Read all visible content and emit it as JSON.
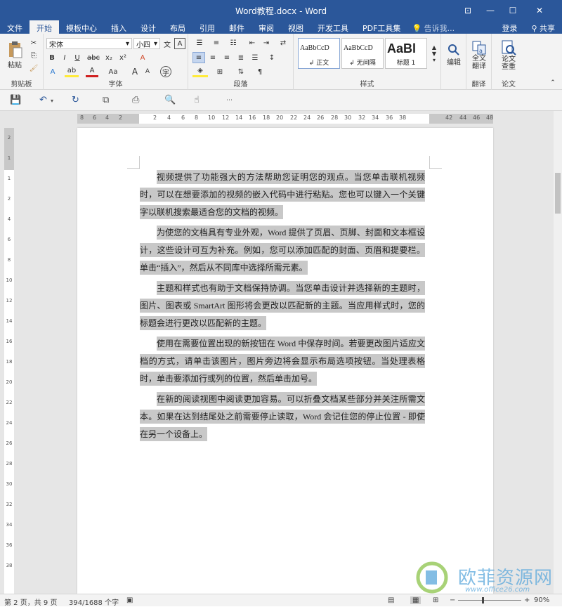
{
  "window": {
    "title": "Word教程.docx - Word",
    "minimize": "—",
    "maximize": "☐",
    "close": "✕",
    "ribbon_display": "⊡"
  },
  "tabs": [
    "文件",
    "开始",
    "模板中心",
    "插入",
    "设计",
    "布局",
    "引用",
    "邮件",
    "审阅",
    "视图",
    "开发工具",
    "PDF工具集"
  ],
  "active_tab": "开始",
  "tell_me": "告诉我...",
  "login": "登录",
  "share": "共享",
  "ribbon": {
    "clipboard": {
      "paste": "粘贴",
      "label": "剪贴板"
    },
    "font": {
      "name": "宋体",
      "size": "小四",
      "label": "字体",
      "bold": "B",
      "italic": "I",
      "underline": "U",
      "strike": "abc",
      "sub": "x₂",
      "sup": "x²",
      "grow": "A",
      "shrink": "A",
      "case": "Aa",
      "clear": "A",
      "phonetic": "文",
      "border": "A",
      "effect": "A",
      "highlight": "ab",
      "color": "A",
      "enclose": "字"
    },
    "paragraph": {
      "label": "段落"
    },
    "styles": {
      "label": "样式",
      "items": [
        {
          "sample": "AaBbCcD",
          "name": "↲ 正文"
        },
        {
          "sample": "AaBbCcD",
          "name": "↲ 无间隔"
        },
        {
          "sample": "AaBl",
          "name": "标题 1"
        }
      ]
    },
    "editing": {
      "label": "编辑"
    },
    "translate": {
      "btn": "全文\n翻译",
      "line1": "全文",
      "line2": "翻译",
      "label": "翻译"
    },
    "paper": {
      "line1": "论文",
      "line2": "查重",
      "label": "论文"
    }
  },
  "ruler": {
    "h_numbers": [
      "8",
      "6",
      "4",
      "2",
      "2",
      "4",
      "6",
      "8",
      "10",
      "12",
      "14",
      "16",
      "18",
      "20",
      "22",
      "24",
      "26",
      "28",
      "30",
      "32",
      "34",
      "36",
      "38",
      "42",
      "44",
      "46",
      "48"
    ],
    "v_numbers": [
      "2",
      "1",
      "1",
      "2",
      "4",
      "6",
      "8",
      "10",
      "12",
      "14",
      "16",
      "18",
      "20",
      "22",
      "24",
      "26",
      "28",
      "30",
      "32",
      "34",
      "36",
      "38"
    ],
    "corner": "L"
  },
  "document": {
    "paragraphs": [
      "视频提供了功能强大的方法帮助您证明您的观点。当您单击联机视频时，可以在想要添加的视频的嵌入代码中进行粘贴。您也可以键入一个关键字以联机搜索最适合您的文档的视频。",
      "为使您的文档具有专业外观，Word 提供了页眉、页脚、封面和文本框设计，这些设计可互为补充。例如，您可以添加匹配的封面、页眉和提要栏。单击“插入”，然后从不同库中选择所需元素。",
      "主题和样式也有助于文档保持协调。当您单击设计并选择新的主题时，图片、图表或 SmartArt 图形将会更改以匹配新的主题。当应用样式时，您的标题会进行更改以匹配新的主题。",
      "使用在需要位置出现的新按钮在 Word 中保存时间。若要更改图片适应文档的方式，请单击该图片，图片旁边将会显示布局选项按钮。当处理表格时，单击要添加行或列的位置，然后单击加号。",
      "在新的阅读视图中阅读更加容易。可以折叠文档某些部分并关注所需文本。如果在达到结尾处之前需要停止读取，Word 会记住您的停止位置 - 即使在另一个设备上。"
    ]
  },
  "status": {
    "page": "第 2 页，共 9 页",
    "words": "394/1688 个字",
    "zoom": "90%",
    "zoom_minus": "−",
    "zoom_plus": "+"
  },
  "watermark": {
    "title": "欧菲资源网",
    "subtitle": "www.office26.com"
  },
  "colors": {
    "accent": "#2b579a",
    "highlight": "#c8c8c8"
  }
}
